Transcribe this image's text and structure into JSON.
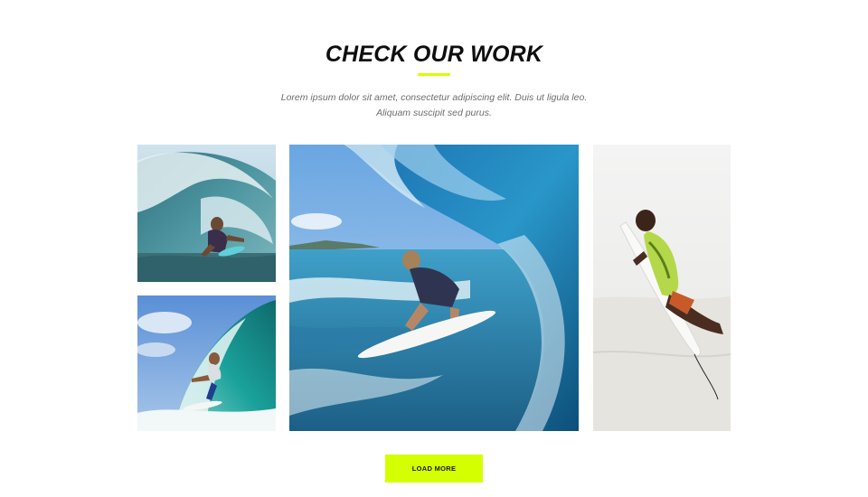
{
  "section": {
    "title": "CHECK OUR WORK",
    "description_line1": "Lorem ipsum dolor sit amet, consectetur adipiscing elit. Duis ut ligula leo.",
    "description_line2": "Aliquam suscipit sed purus.",
    "accent_color": "#d4ff00"
  },
  "gallery": {
    "images": [
      {
        "alt": "Surfer riding inside a wave barrel"
      },
      {
        "alt": "Surfer on a breaking turquoise wave"
      },
      {
        "alt": "Surfer crouching inside a large blue wave"
      },
      {
        "alt": "Surfer jumping with surfboard"
      }
    ]
  },
  "load_more": {
    "label": "LOAD MORE"
  }
}
